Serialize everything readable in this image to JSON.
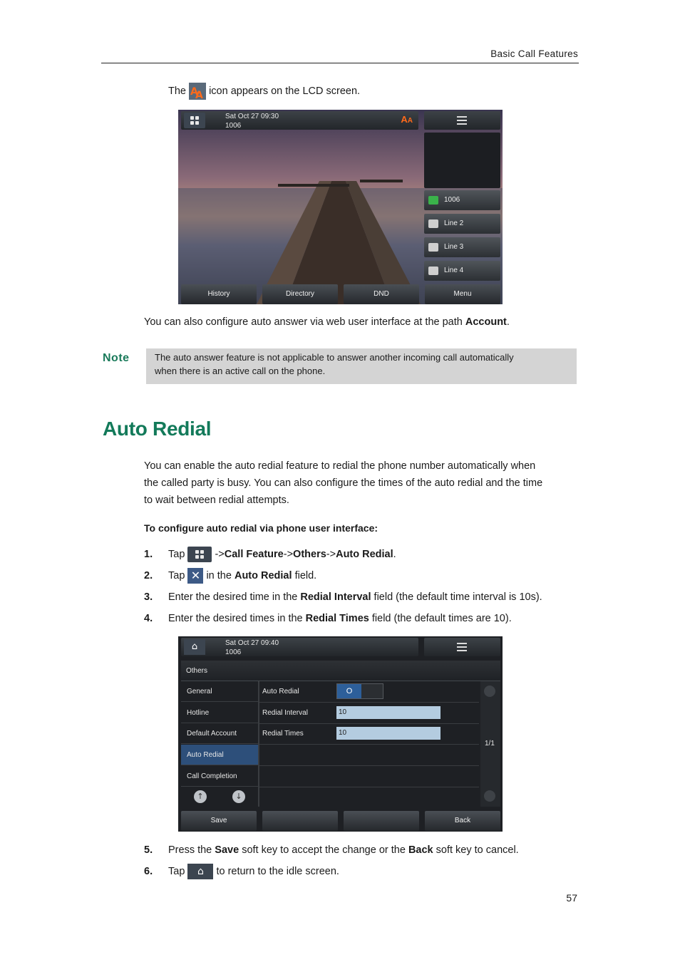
{
  "header": {
    "section_title": "Basic Call Features"
  },
  "intro": {
    "prefix": "The",
    "suffix": "icon appears on the LCD screen."
  },
  "screen1": {
    "datetime": "Sat Oct 27 09:30",
    "account": "1006",
    "lines": [
      "1006",
      "Line 2",
      "Line 3",
      "Line 4"
    ],
    "softkeys": [
      "History",
      "Directory",
      "DND",
      "Menu"
    ]
  },
  "web_config": {
    "text": "You can also configure auto answer via web user interface at the path",
    "path": "Account",
    "end": "."
  },
  "note": {
    "label": "Note",
    "line1": "The auto answer feature is not applicable to answer another incoming call automatically",
    "line2": "when there is an active call on the phone."
  },
  "section": {
    "heading": "Auto Redial",
    "para_line1": "You can enable the auto redial feature to redial the phone number automatically when",
    "para_line2": "the called party is busy. You can also configure the times of the auto redial and the time",
    "para_line3": "to wait between redial attempts.",
    "procedure_title": "To configure auto redial via phone user interface:"
  },
  "steps": {
    "s1": {
      "num": "1.",
      "pre": "Tap",
      "path1": "Call Feature",
      "path2": "Others",
      "path3": "Auto Redial",
      "arrow": "->",
      "end": "."
    },
    "s2": {
      "num": "2.",
      "pre": "Tap",
      "mid": "in the",
      "field": "Auto Redial",
      "end": "field."
    },
    "s3": {
      "num": "3.",
      "pre": "Enter the desired time in the",
      "field": "Redial Interval",
      "end": "field (the default time interval is 10s)."
    },
    "s4": {
      "num": "4.",
      "pre": "Enter the desired times in the",
      "field": "Redial Times",
      "end": "field (the default times are 10)."
    },
    "s5": {
      "num": "5.",
      "pre": "Press the",
      "key1": "Save",
      "mid": "soft key to accept the change or the",
      "key2": "Back",
      "end": "soft key to cancel."
    },
    "s6": {
      "num": "6.",
      "pre": "Tap",
      "end": "to return to the idle screen."
    }
  },
  "screen2": {
    "datetime": "Sat Oct 27 09:40",
    "account": "1006",
    "title": "Others",
    "menu": [
      "General",
      "Hotline",
      "Default Account",
      "Auto Redial",
      "Call Completion"
    ],
    "selected_menu": "Auto Redial",
    "fields": [
      {
        "label": "Auto Redial",
        "value": "O"
      },
      {
        "label": "Redial Interval",
        "value": "10"
      },
      {
        "label": "Redial Times",
        "value": "10"
      }
    ],
    "page": "1/1",
    "softkeys": [
      "Save",
      "",
      "",
      "Back"
    ]
  },
  "footer": {
    "page_number": "57"
  },
  "colors": {
    "heading": "#137a5a",
    "note_bg": "#d4d4d4",
    "selected": "#2d4f7a",
    "input": "#b4cce0"
  }
}
